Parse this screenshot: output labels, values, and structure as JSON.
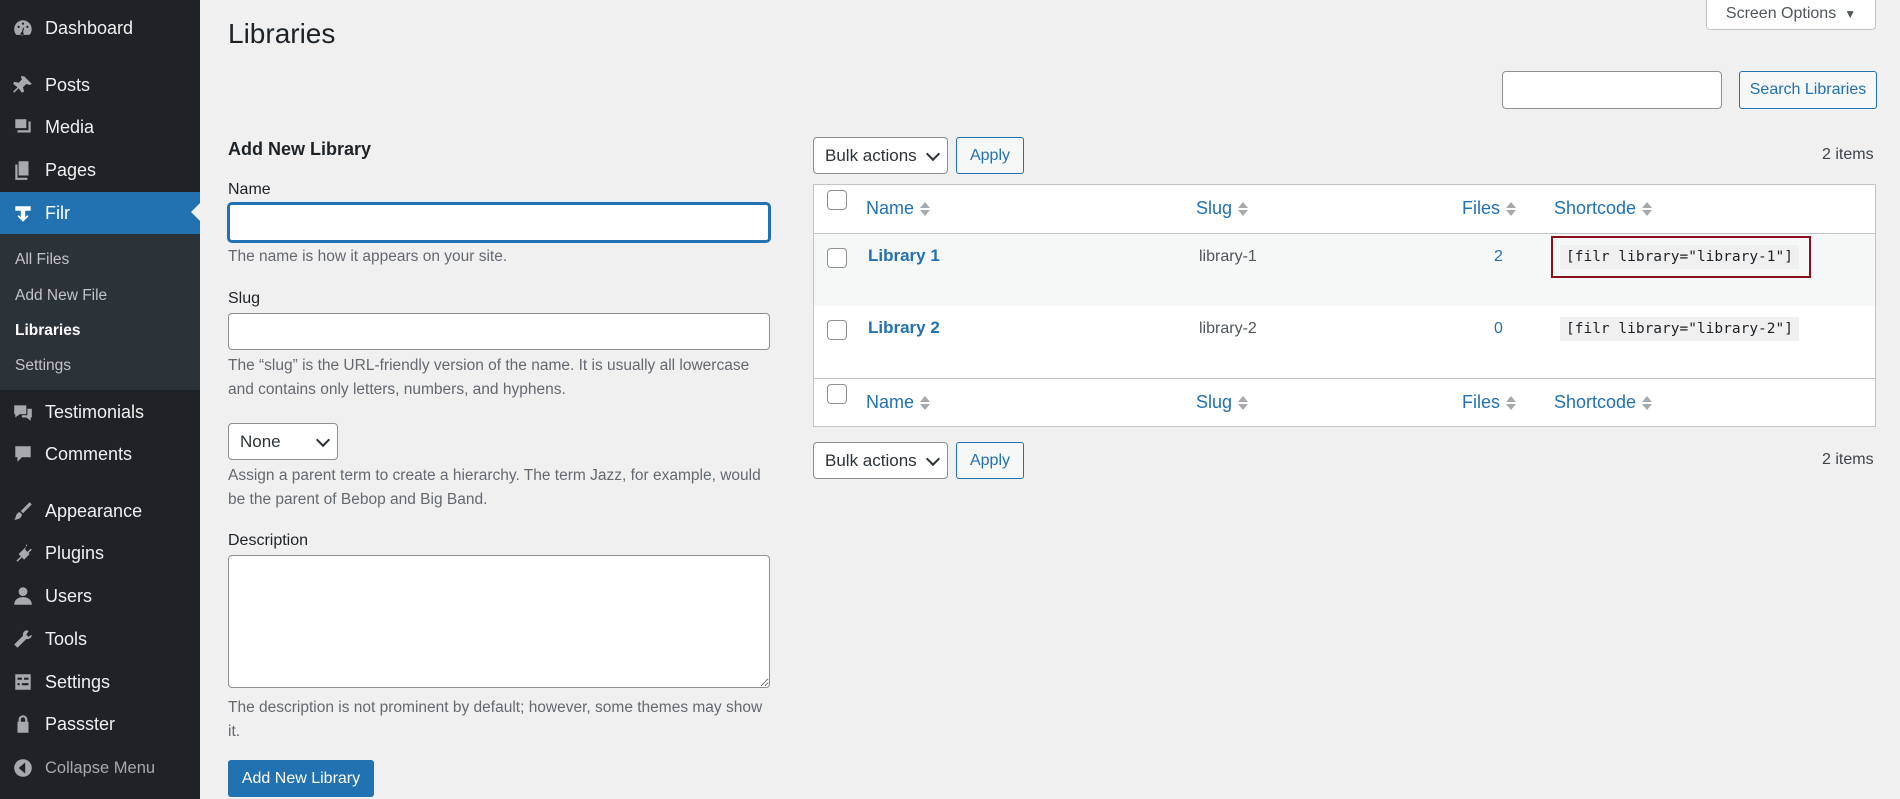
{
  "sidebar": {
    "items": [
      {
        "label": "Dashboard",
        "icon": "dashboard-icon"
      },
      {
        "label": "Posts",
        "icon": "pushpin-icon"
      },
      {
        "label": "Media",
        "icon": "media-icon"
      },
      {
        "label": "Pages",
        "icon": "pages-icon"
      },
      {
        "label": "Filr",
        "icon": "download-icon"
      },
      {
        "label": "Testimonials",
        "icon": "testimonials-icon"
      },
      {
        "label": "Comments",
        "icon": "comment-icon"
      },
      {
        "label": "Appearance",
        "icon": "paintbrush-icon"
      },
      {
        "label": "Plugins",
        "icon": "plug-icon"
      },
      {
        "label": "Users",
        "icon": "user-icon"
      },
      {
        "label": "Tools",
        "icon": "wrench-icon"
      },
      {
        "label": "Settings",
        "icon": "settings-icon"
      },
      {
        "label": "Passster",
        "icon": "lock-icon"
      }
    ],
    "submenu": [
      "All Files",
      "Add New File",
      "Libraries",
      "Settings"
    ],
    "collapse_label": "Collapse Menu"
  },
  "header": {
    "title": "Libraries",
    "screen_options": "Screen Options"
  },
  "search": {
    "placeholder": "",
    "button": "Search Libraries"
  },
  "form": {
    "title": "Add New Library",
    "name_label": "Name",
    "name_help": "The name is how it appears on your site.",
    "slug_label": "Slug",
    "slug_help": "The “slug” is the URL-friendly version of the name. It is usually all lowercase and contains only letters, numbers, and hyphens.",
    "parent_value": "None",
    "parent_help": "Assign a parent term to create a hierarchy. The term Jazz, for example, would be the parent of Bebop and Big Band.",
    "description_label": "Description",
    "description_help": "The description is not prominent by default; however, some themes may show it.",
    "submit": "Add New Library"
  },
  "table": {
    "bulk_actions": "Bulk actions",
    "apply": "Apply",
    "item_count": "2 items",
    "columns": [
      "Name",
      "Slug",
      "Files",
      "Shortcode"
    ],
    "rows": [
      {
        "name": "Library 1",
        "slug": "library-1",
        "files": "2",
        "shortcode": "[filr library=\"library-1\"]"
      },
      {
        "name": "Library 2",
        "slug": "library-2",
        "files": "0",
        "shortcode": "[filr library=\"library-2\"]"
      }
    ]
  },
  "colors": {
    "accent": "#2271b1",
    "sidebar_bg": "#1d2327",
    "highlight": "#8a0f1f"
  }
}
